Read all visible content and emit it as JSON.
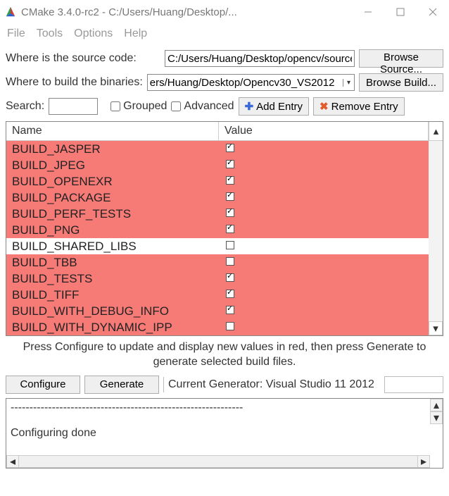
{
  "window": {
    "title": "CMake 3.4.0-rc2 - C:/Users/Huang/Desktop/..."
  },
  "menu": {
    "file": "File",
    "tools": "Tools",
    "options": "Options",
    "help": "Help"
  },
  "source": {
    "label": "Where is the source code:",
    "value": "C:/Users/Huang/Desktop/opencv/sources",
    "browse": "Browse Source..."
  },
  "build": {
    "label": "Where to build the binaries:",
    "value": "ers/Huang/Desktop/Opencv30_VS2012",
    "browse": "Browse Build..."
  },
  "search": {
    "label": "Search:",
    "value": ""
  },
  "grouped": {
    "label": "Grouped",
    "checked": false
  },
  "advanced": {
    "label": "Advanced",
    "checked": false
  },
  "addentry": "Add Entry",
  "removeentry": "Remove Entry",
  "table": {
    "header_name": "Name",
    "header_value": "Value",
    "rows": [
      {
        "name": "BUILD_JASPER",
        "checked": true,
        "highlight": true
      },
      {
        "name": "BUILD_JPEG",
        "checked": true,
        "highlight": true
      },
      {
        "name": "BUILD_OPENEXR",
        "checked": true,
        "highlight": true
      },
      {
        "name": "BUILD_PACKAGE",
        "checked": true,
        "highlight": true
      },
      {
        "name": "BUILD_PERF_TESTS",
        "checked": true,
        "highlight": true
      },
      {
        "name": "BUILD_PNG",
        "checked": true,
        "highlight": true
      },
      {
        "name": "BUILD_SHARED_LIBS",
        "checked": false,
        "highlight": false
      },
      {
        "name": "BUILD_TBB",
        "checked": false,
        "highlight": true
      },
      {
        "name": "BUILD_TESTS",
        "checked": true,
        "highlight": true
      },
      {
        "name": "BUILD_TIFF",
        "checked": true,
        "highlight": true
      },
      {
        "name": "BUILD_WITH_DEBUG_INFO",
        "checked": true,
        "highlight": true
      },
      {
        "name": "BUILD_WITH_DYNAMIC_IPP",
        "checked": false,
        "highlight": true
      }
    ]
  },
  "hint": "Press Configure to update and display new values in red, then press Generate to generate selected build files.",
  "configure": "Configure",
  "generate": "Generate",
  "generator_label": "Current Generator: Visual Studio 11 2012",
  "output": "--------------------------------------------------------------\n\nConfiguring done"
}
